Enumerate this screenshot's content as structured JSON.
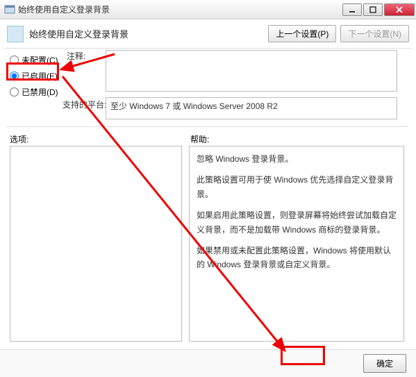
{
  "window": {
    "title": "始终使用自定义登录背景"
  },
  "header": {
    "title": "始终使用自定义登录背景",
    "prev": "上一个设置(P)",
    "next": "下一个设置(N)"
  },
  "radios": {
    "notconfig": "未配置(C)",
    "enabled": "已启用(E)",
    "disabled": "已禁用(D)",
    "selected": "enabled"
  },
  "comment": {
    "label": "注释:",
    "value": ""
  },
  "platform": {
    "label": "支持的平台:",
    "value": "至少 Windows 7 或 Windows Server 2008 R2"
  },
  "options": {
    "label": "选项:"
  },
  "help": {
    "label": "帮助:",
    "p1": "忽略 Windows 登录背景。",
    "p2": "此策略设置可用于使 Windows 优先选择自定义登录背景。",
    "p3": "如果启用此策略设置，则登录屏幕将始终尝试加载自定义背景，而不是加载带 Windows 商标的登录背景。",
    "p4": "如果禁用或未配置此策略设置，Windows 将使用默认的 Windows 登录背景或自定义背景。"
  },
  "footer": {
    "ok": "确定"
  }
}
